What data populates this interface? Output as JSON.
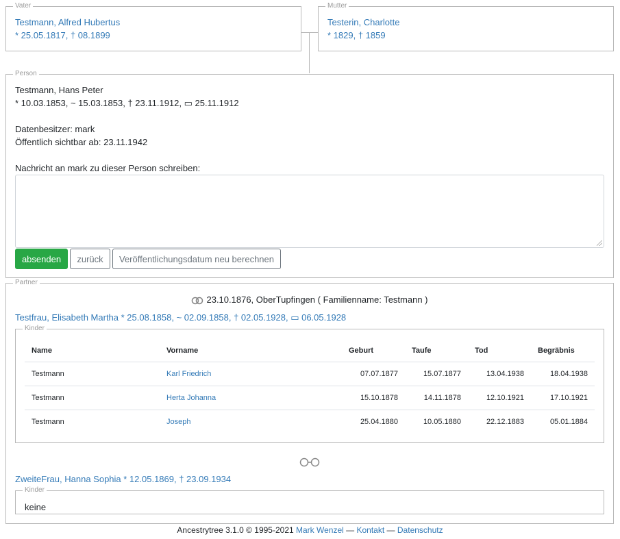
{
  "vater": {
    "legend": "Vater",
    "name": "Testmann, Alfred Hubertus",
    "dates": "* 25.05.1817, † 08.1899"
  },
  "mutter": {
    "legend": "Mutter",
    "name": "Testerin, Charlotte",
    "dates": "* 1829, † 1859"
  },
  "person": {
    "legend": "Person",
    "name": "Testmann, Hans Peter",
    "dates": "* 10.03.1853, ~ 15.03.1853, † 23.11.1912, ▭ 25.11.1912",
    "owner": "Datenbesitzer: mark",
    "visible_from": "Öffentlich sichtbar ab: 23.11.1942",
    "message_label": "Nachricht an mark zu dieser Person schreiben:",
    "message_value": "",
    "buttons": {
      "send": "absenden",
      "back": "zurück",
      "recalc": "Veröffentlichungsdatum neu berechnen"
    }
  },
  "partner": {
    "legend": "Partner",
    "marriage": "23.10.1876, OberTupfingen ( Familienname: Testmann )",
    "partners": [
      {
        "name": "Testfrau, Elisabeth Martha * 25.08.1858, ~ 02.09.1858, † 02.05.1928, ▭ 06.05.1928",
        "kinder_legend": "Kinder",
        "columns": [
          "Name",
          "Vorname",
          "Geburt",
          "Taufe",
          "Tod",
          "Begräbnis"
        ],
        "rows": [
          {
            "name": "Testmann",
            "vorname": "Karl Friedrich",
            "geburt": "07.07.1877",
            "taufe": "15.07.1877",
            "tod": "13.04.1938",
            "begraebnis": "18.04.1938"
          },
          {
            "name": "Testmann",
            "vorname": "Herta Johanna",
            "geburt": "15.10.1878",
            "taufe": "14.11.1878",
            "tod": "12.10.1921",
            "begraebnis": "17.10.1921"
          },
          {
            "name": "Testmann",
            "vorname": "Joseph",
            "geburt": "25.04.1880",
            "taufe": "10.05.1880",
            "tod": "22.12.1883",
            "begraebnis": "05.01.1884"
          }
        ]
      },
      {
        "name": "ZweiteFrau, Hanna Sophia * 12.05.1869, † 23.09.1934",
        "kinder_legend": "Kinder",
        "kinder_none": "keine"
      }
    ]
  },
  "footer": {
    "text": "Ancestrytree 3.1.0 © 1995-2021",
    "author": "Mark Wenzel",
    "sep1": "—",
    "contact": "Kontakt",
    "sep2": "—",
    "privacy": "Datenschutz"
  },
  "colors": {
    "link": "#337ab7",
    "primary_button": "#28a745",
    "border": "#b8b8b8"
  }
}
